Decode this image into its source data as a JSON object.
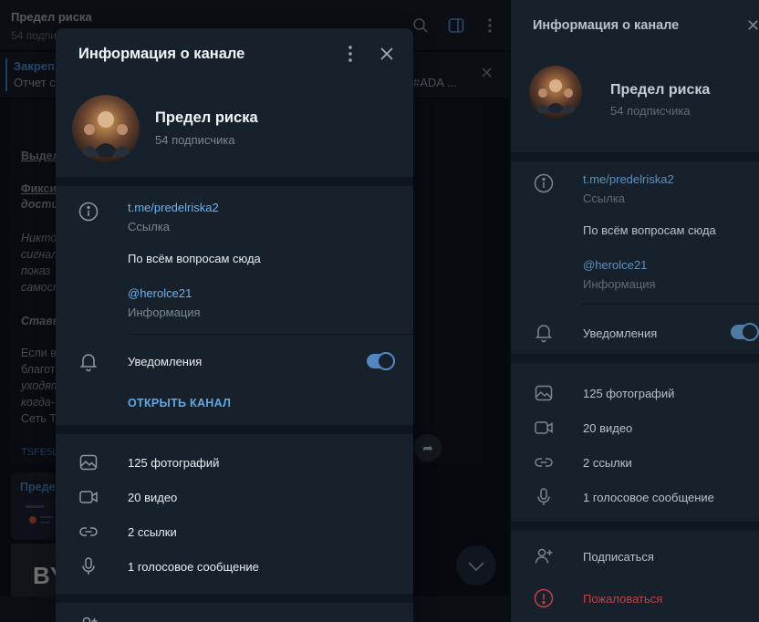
{
  "background_chat": {
    "title": "Предел риска",
    "subtitle": "54 подпис",
    "pinned_title": "Закреп",
    "pinned_text": "Отчет с",
    "pinned_tail": "#ADA ...",
    "fragments": [
      "Выдел",
      "Фикси",
      "дости",
      "Никто",
      "сигнал",
      "показ",
      "самост",
      "Ставь",
      "Если в",
      "благот",
      "уходят",
      "когда-",
      "Сеть Т",
      "TSFE5L"
    ],
    "preview_title": "Предел",
    "bottom_image_text": "BY"
  },
  "modal": {
    "title": "Информация о канале",
    "channel_name": "Предел риска",
    "subscribers": "54 подписчика",
    "link": "t.me/predelriska2",
    "link_caption": "Ссылка",
    "description": "По всём вопросам сюда",
    "mention": "@herolce21",
    "info_caption": "Информация",
    "notifications_label": "Уведомления",
    "notifications_on": true,
    "open_channel_label": "ОТКРЫТЬ КАНАЛ",
    "media": {
      "photos": "125 фотографий",
      "videos": "20 видео",
      "links": "2 ссылки",
      "voice": "1 голосовое сообщение"
    }
  },
  "right_panel": {
    "title": "Информация о канале",
    "channel_name": "Предел риска",
    "subscribers": "54 подписчика",
    "link": "t.me/predelriska2",
    "link_caption": "Ссылка",
    "description": "По всём вопросам сюда",
    "mention": "@herolce21",
    "info_caption": "Информация",
    "notifications_label": "Уведомления",
    "notifications_on": true,
    "media": {
      "photos": "125 фотографий",
      "videos": "20 видео",
      "links": "2 ссылки",
      "voice": "1 голосовое сообщение"
    },
    "subscribe_label": "Подписаться",
    "report_label": "Пожаловаться"
  },
  "colors": {
    "accent": "#5288c1",
    "link": "#6ab3f3",
    "danger": "#c44141",
    "panel_bg": "#17212b"
  },
  "icons": [
    "search-icon",
    "sidebar-toggle-icon",
    "more-vertical-icon",
    "close-icon",
    "info-icon",
    "bell-icon",
    "photo-icon",
    "video-icon",
    "link-icon",
    "microphone-icon",
    "add-user-icon",
    "report-icon",
    "share-arrow-icon",
    "chevron-down-icon"
  ]
}
